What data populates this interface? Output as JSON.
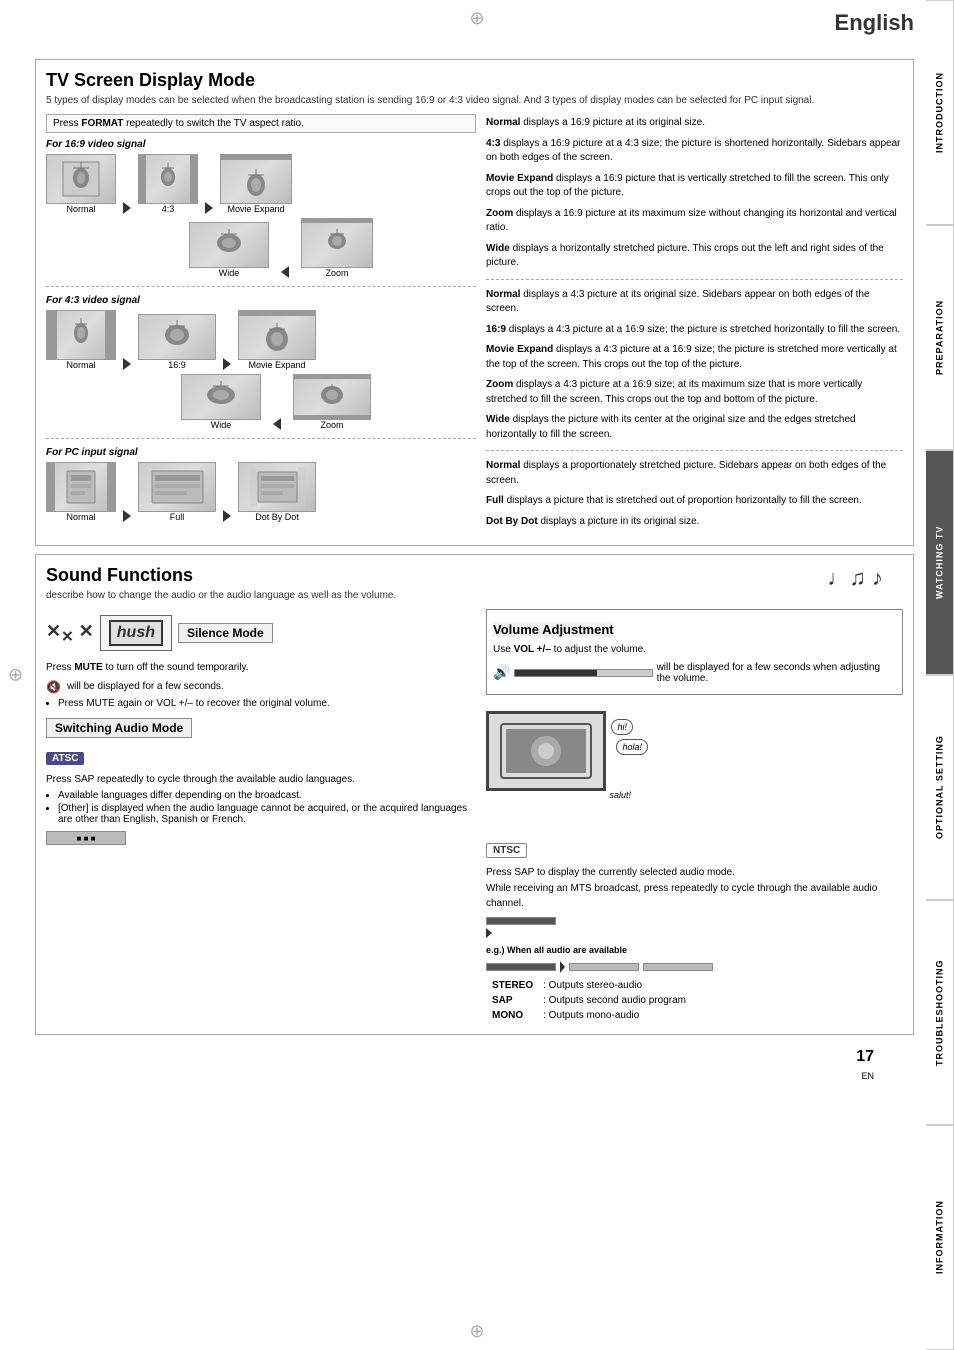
{
  "page": {
    "language": "English",
    "page_number": "17",
    "page_suffix": "EN"
  },
  "side_tabs": [
    {
      "id": "introduction",
      "label": "INTRODUCTION",
      "active": false
    },
    {
      "id": "preparation",
      "label": "PREPARATION",
      "active": false
    },
    {
      "id": "watching_tv",
      "label": "WATCHING TV",
      "active": true
    },
    {
      "id": "optional_setting",
      "label": "OPTIONAL SETTING",
      "active": false
    },
    {
      "id": "troubleshooting",
      "label": "TROUBLESHOOTING",
      "active": false
    },
    {
      "id": "information",
      "label": "INFORMATION",
      "active": false
    }
  ],
  "tv_screen_section": {
    "title": "TV Screen Display Mode",
    "subtitle": "5 types of display modes can be selected when the broadcasting station is sending 16:9 or 4:3 video signal. And 3 types of display modes can be selected for PC input signal.",
    "format_instruction": "Press FORMAT repeatedly to switch the TV aspect ratio.",
    "signal_groups": [
      {
        "label": "For 16:9 video signal",
        "modes": [
          "Normal",
          "4:3",
          "Movie Expand",
          "Wide",
          "Zoom"
        ]
      },
      {
        "label": "For 4:3 video signal",
        "modes": [
          "Normal",
          "16:9",
          "Movie Expand",
          "Wide",
          "Zoom"
        ]
      },
      {
        "label": "For PC input signal",
        "modes": [
          "Normal",
          "Full",
          "Dot By Dot"
        ]
      }
    ],
    "descriptions_169": [
      {
        "term": "Normal",
        "text": "displays a 16:9 picture at its original size."
      },
      {
        "term": "4:3",
        "text": "displays a 16:9 picture at a 4:3 size; the picture is shortened horizontally. Sidebars appear on both edges of the screen."
      },
      {
        "term": "Movie Expand",
        "text": "displays a 16:9 picture that is vertically stretched to fill the screen. This only crops out the top of the picture."
      },
      {
        "term": "Zoom",
        "text": "displays a 16:9 picture at its maximum size without changing its horizontal and vertical ratio."
      },
      {
        "term": "Wide",
        "text": "displays a horizontally stretched picture. This crops out the left and right sides of the picture."
      }
    ],
    "descriptions_43": [
      {
        "term": "Normal",
        "text": "displays a 4:3 picture at its original size. Sidebars appear on both edges of the screen."
      },
      {
        "term": "16:9",
        "text": "displays a 4:3 picture at a 16:9 size; the picture is stretched horizontally to fill the screen."
      },
      {
        "term": "Movie Expand",
        "text": "displays a 4:3 picture at a 16:9 size; the picture is stretched more vertically at the top of the screen. This crops out the top of the picture."
      },
      {
        "term": "Zoom",
        "text": "displays a 4:3 picture at a 16:9 size; at its maximum size that is more vertically stretched to fill the screen. This crops out the top and bottom of the picture."
      },
      {
        "term": "Wide",
        "text": "displays the picture with its center at the original size and the edges stretched horizontally to fill the screen."
      }
    ],
    "descriptions_pc": [
      {
        "term": "Normal",
        "text": "displays a proportionately stretched picture. Sidebars appear on both edges of the screen."
      },
      {
        "term": "Full",
        "text": "displays a picture that is stretched out of proportion horizontally to fill the screen."
      },
      {
        "term": "Dot By Dot",
        "text": "displays a picture in its original size."
      }
    ]
  },
  "sound_section": {
    "title": "Sound Functions",
    "subtitle": "describe how to change the audio or  the audio language as well as the volume.",
    "silence_mode": {
      "label": "Silence Mode",
      "hush_text": "hush",
      "instruction": "Press MUTE to turn off the sound temporarily.",
      "note1": "will be displayed for a few seconds.",
      "bullet1": "Press MUTE again or VOL +/– to recover the original volume."
    },
    "switching_audio": {
      "label": "Switching Audio Mode",
      "atsc_badge": "ATSC",
      "ntsc_badge": "NTSC",
      "atsc_instruction": "Press SAP repeatedly to cycle through the available audio languages.",
      "atsc_bullets": [
        "Available languages differ depending on the broadcast.",
        "[Other] is displayed when the audio language cannot be acquired, or the acquired languages are other than English, Spanish or French."
      ],
      "ntsc_instruction": "Press SAP to display the currently selected audio mode.",
      "ntsc_note": "While receiving an MTS broadcast, press repeatedly to cycle through the available audio channel.",
      "example_note": "e.g.) When all audio are available",
      "stereo_labels": [
        {
          "term": "STEREO",
          "text": ": Outputs stereo-audio"
        },
        {
          "term": "SAP",
          "text": ": Outputs second audio program"
        },
        {
          "term": "MONO",
          "text": ": Outputs mono-audio"
        }
      ]
    },
    "volume": {
      "label": "Volume Adjustment",
      "instruction": "Use VOL +/– to adjust the volume.",
      "note": "will be displayed for a few seconds when adjusting the volume."
    }
  }
}
